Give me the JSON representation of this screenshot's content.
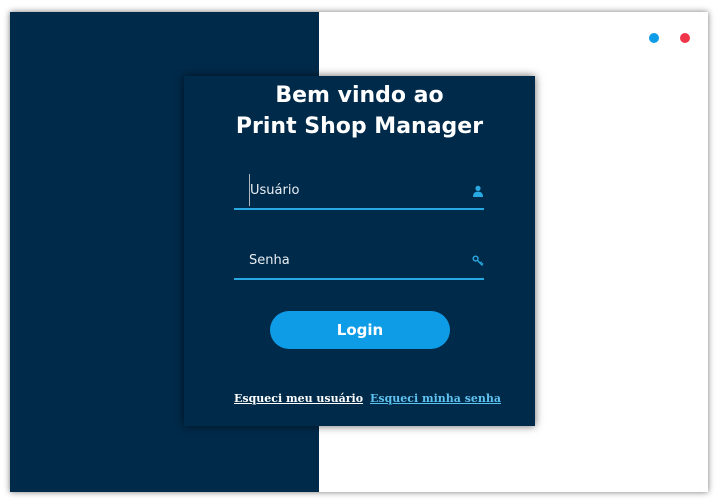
{
  "window": {
    "controls": [
      {
        "name": "minimize",
        "color": "#0f9ce6"
      },
      {
        "name": "close",
        "color": "#f0354a"
      }
    ]
  },
  "colors": {
    "panel": "#002a4a",
    "accent": "#29a9e1",
    "button": "#0f9ce6",
    "link_secondary": "#5ec2f0"
  },
  "login": {
    "title_line1": "Bem vindo ao",
    "title_line2": "Print Shop Manager",
    "username_placeholder": "Usuário",
    "username_icon": "user-icon",
    "password_placeholder": "Senha",
    "password_icon": "key-icon",
    "button_label": "Login",
    "forgot_user_label": "Esqueci meu usuário",
    "forgot_password_label": "Esqueci minha senha"
  }
}
